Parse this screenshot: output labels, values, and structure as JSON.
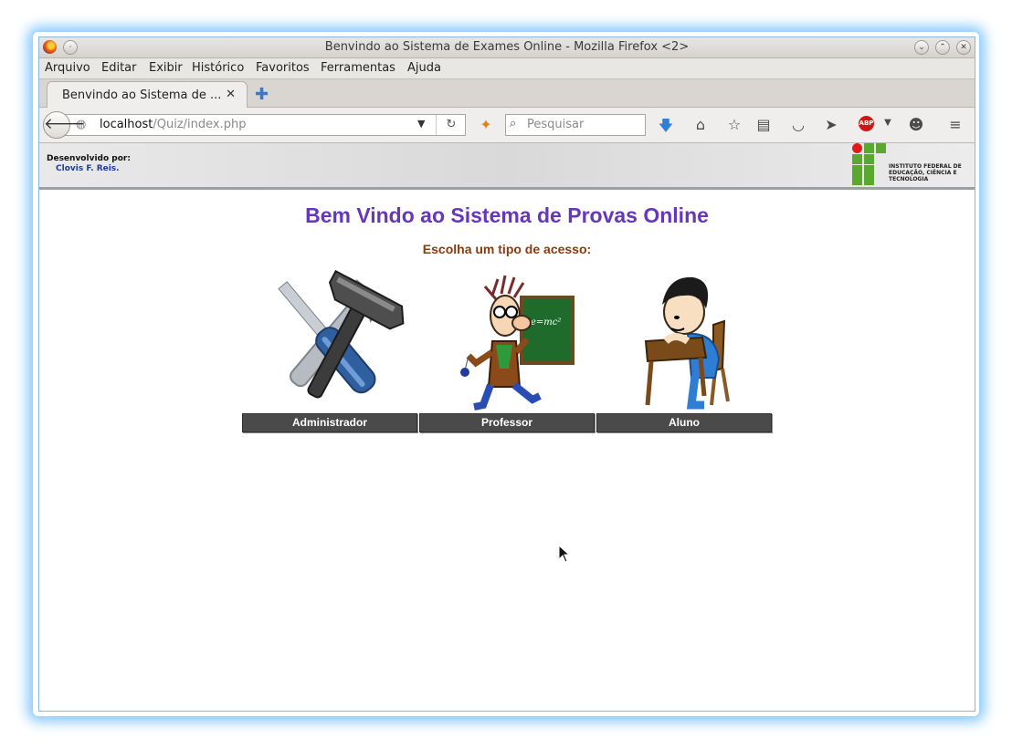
{
  "window": {
    "title": "Benvindo ao Sistema de Exames Online - Mozilla Firefox <2>"
  },
  "menu": [
    "Arquivo",
    "Editar",
    "Exibir",
    "Histórico",
    "Favoritos",
    "Ferramentas",
    "Ajuda"
  ],
  "tab": {
    "label": "Benvindo ao Sistema de ...",
    "close": "✕",
    "new_tab": "✚"
  },
  "navbar": {
    "url_host": "localhost",
    "url_path": "/Quiz/index.php",
    "search_placeholder": "Pesquisar",
    "abp_label": "ABP"
  },
  "banner": {
    "developed_by": "Desenvolvido por:",
    "author": "Clovis F. Reis.",
    "logo_text_1": "INSTITUTO FEDERAL DE",
    "logo_text_2": "EDUCAÇÃO, CIÊNCIA E TECNOLOGIA"
  },
  "page": {
    "title": "Bem Vindo ao Sistema de Provas Online",
    "subtitle": "Escolha um tipo de acesso:",
    "cards": [
      {
        "label": "Administrador",
        "icon": "tools-icon"
      },
      {
        "label": "Professor",
        "icon": "professor-icon"
      },
      {
        "label": "Aluno",
        "icon": "student-icon"
      }
    ]
  },
  "colors": {
    "title": "#6637b8",
    "subtitle": "#8a3a0c",
    "button_bg": "#4a4a4a",
    "glow": "#5ab4ff"
  }
}
